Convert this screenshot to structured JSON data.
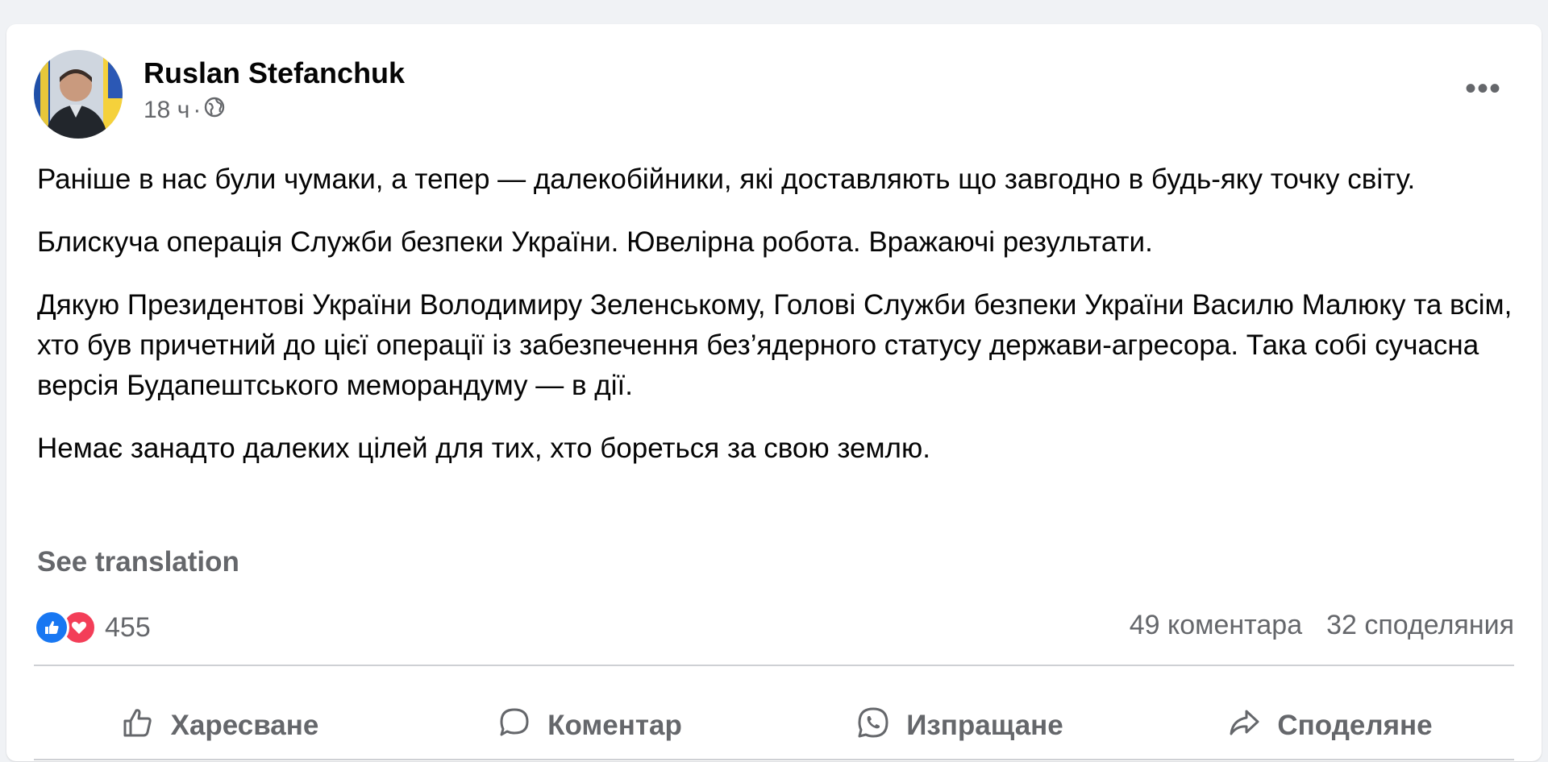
{
  "post": {
    "author": "Ruslan Stefanchuk",
    "time": "18 ч",
    "separator": "·",
    "audience_icon": "globe-icon",
    "more_icon": "more-options-icon",
    "more_label": "•••",
    "paragraphs": [
      "Раніше в нас були чумаки, а тепер — далекобійники, які доставляють що завгодно в будь-яку точку світу.",
      "Блискуча операція Служби безпеки України. Ювелірна робота. Вражаючі результати.",
      "Дякую Президентові України Володимиру Зеленському, Голові Служби безпеки України Василю Малюку та всім, хто був причетний до цієї операції із забезпечення без’ядерного статусу держави-агресора. Така собі сучасна версія Будапештського меморандуму — в дії.",
      "Немає занадто далеких цілей для тих, хто бореться за свою землю."
    ],
    "see_translation": "See translation"
  },
  "stats": {
    "reaction_icons": [
      "like-reaction-icon",
      "love-reaction-icon"
    ],
    "reactions_count": "455",
    "comments": "49 коментара",
    "shares": "32 споделяния"
  },
  "actions": {
    "like": "Харесване",
    "comment": "Коментар",
    "send": "Изпращане",
    "share": "Споделяне"
  },
  "colors": {
    "background": "#f0f2f5",
    "card": "#ffffff",
    "primary_text": "#050505",
    "secondary_text": "#65676b",
    "like_blue": "#1877f2",
    "love_red": "#f33e58",
    "divider": "#ced0d4"
  }
}
